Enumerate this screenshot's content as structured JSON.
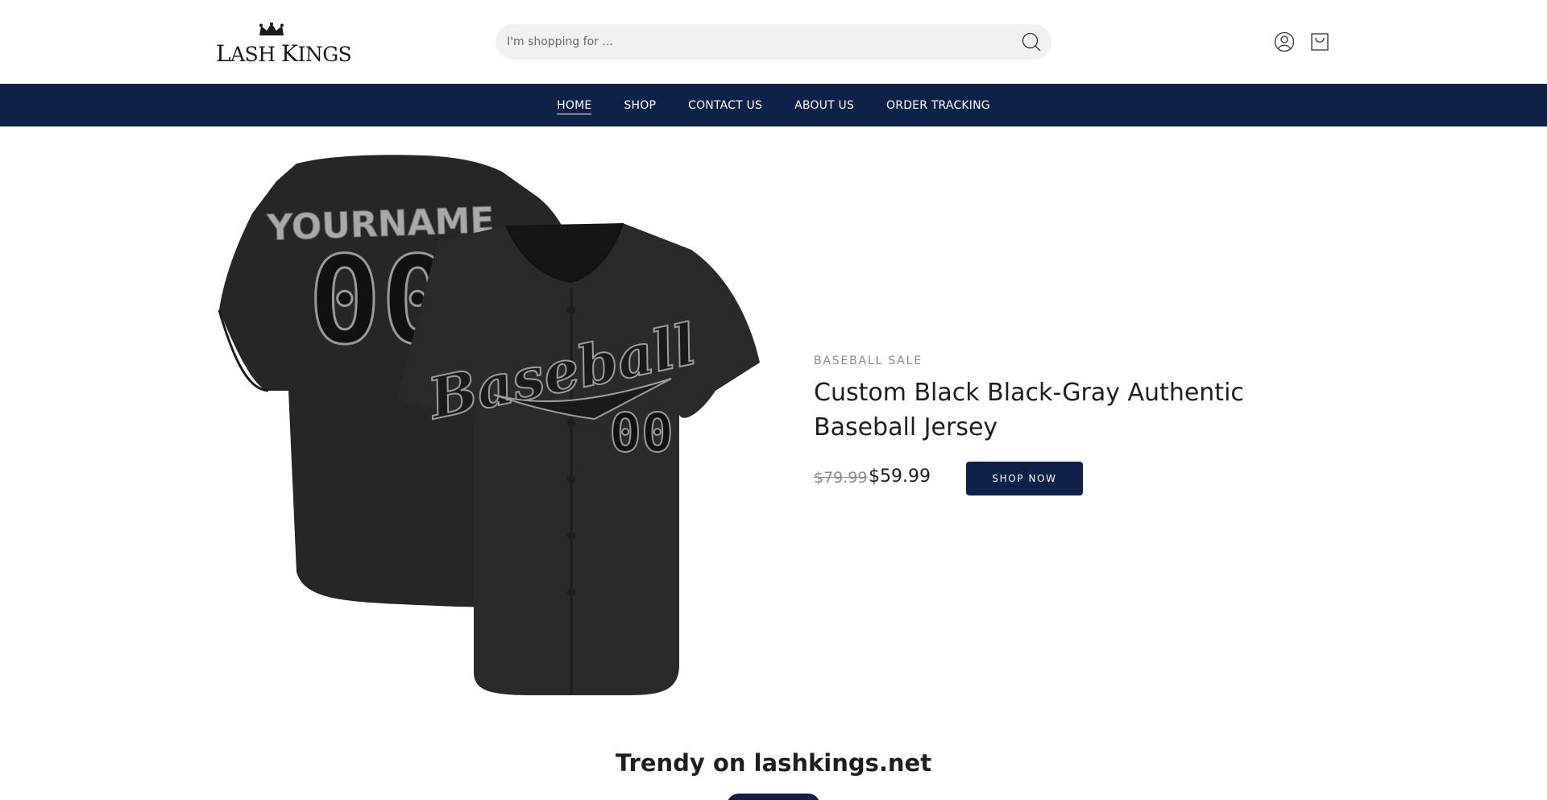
{
  "brand": {
    "name_first": "L",
    "name_rest_1": "ASH ",
    "name_second": "K",
    "name_rest_2": "INGS",
    "icon": "crown-icon"
  },
  "search": {
    "placeholder": "I'm shopping for ...",
    "value": "",
    "icon": "search-icon"
  },
  "header_icons": [
    "user-icon",
    "cart-icon"
  ],
  "nav": {
    "items": [
      {
        "label": "HOME",
        "active": true
      },
      {
        "label": "SHOP"
      },
      {
        "label": "CONTACT US"
      },
      {
        "label": "ABOUT US"
      },
      {
        "label": "ORDER TRACKING"
      }
    ]
  },
  "hero": {
    "jersey_back_name": "YOURNAME",
    "jersey_back_number": "00",
    "jersey_front_script": "Baseball",
    "jersey_front_number": "00",
    "eyebrow": "BASEBALL SALE",
    "title": "Custom Black Black-Gray Authentic Baseball Jersey",
    "price_old": "$79.99",
    "price_new": "$59.99",
    "cta": "SHOP NOW"
  },
  "section": {
    "title": "Trendy on lashkings.net"
  },
  "colors": {
    "nav_bg": "#0d2149",
    "button_bg": "#0d2149",
    "search_bg": "#f1f1f1",
    "muted_text": "#8a8a8a"
  }
}
